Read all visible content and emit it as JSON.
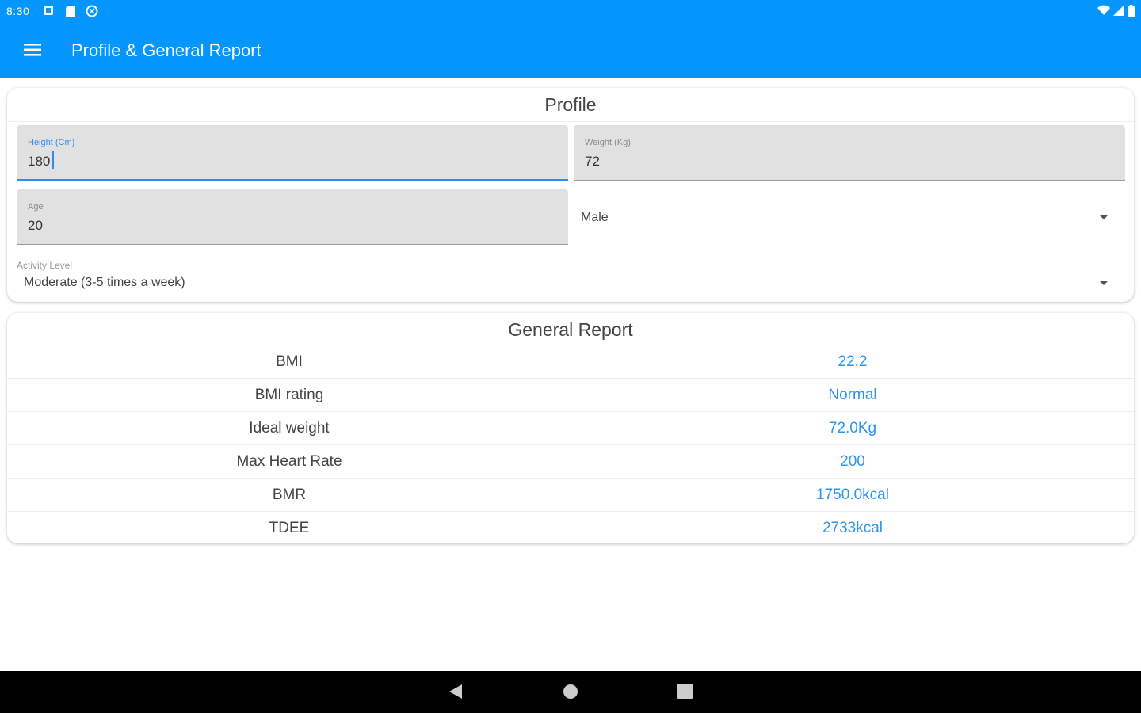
{
  "status_bar": {
    "time": "8:30"
  },
  "app_bar": {
    "title": "Profile & General Report",
    "menu_icon": "menu-icon"
  },
  "profile": {
    "title": "Profile",
    "height_label": "Height (Cm)",
    "height_value": "180",
    "weight_label": "Weight (Kg)",
    "weight_value": "72",
    "age_label": "Age",
    "age_value": "20",
    "gender_value": "Male",
    "activity_label": "Activity Level",
    "activity_value": "Moderate (3-5 times a week)"
  },
  "report": {
    "title": "General Report",
    "rows": [
      {
        "key": "BMI",
        "value": "22.2"
      },
      {
        "key": "BMI rating",
        "value": "Normal"
      },
      {
        "key": "Ideal weight",
        "value": "72.0Kg"
      },
      {
        "key": "Max Heart Rate",
        "value": "200"
      },
      {
        "key": "BMR",
        "value": "1750.0kcal"
      },
      {
        "key": "TDEE",
        "value": "2733kcal"
      }
    ]
  },
  "colors": {
    "app_bar": "#0596fd",
    "accent": "#2d8cf0",
    "report_value": "#2d94f3"
  }
}
